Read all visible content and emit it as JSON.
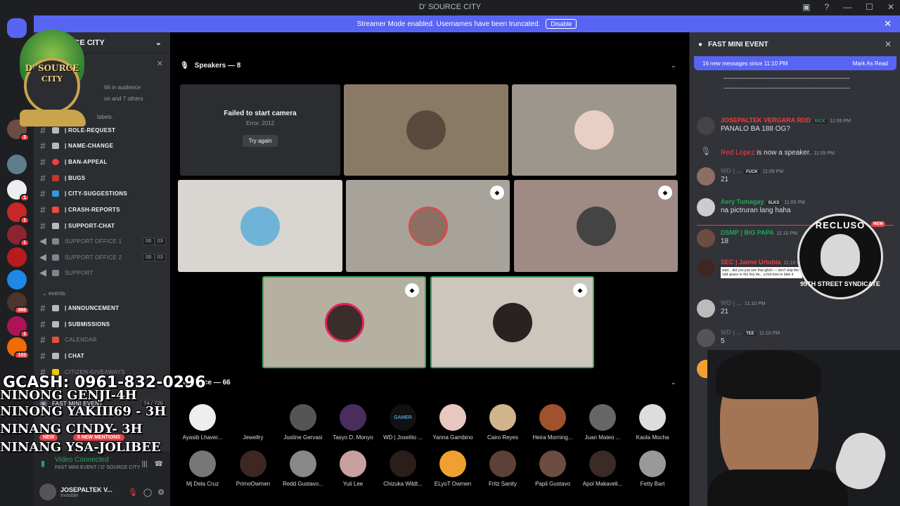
{
  "window": {
    "title": "D' SOURCE CITY"
  },
  "banner": {
    "text": "Streamer Mode enabled. Usernames have been truncated.",
    "button": "Disable"
  },
  "sidebar": {
    "guild_name": "D' SOURCE CITY",
    "stage_info": {
      "audience": "66 in audience",
      "others": "on and 7 others"
    },
    "channels": [
      {
        "label": "| ROLE-REQUEST",
        "dim": false
      },
      {
        "label": "| NAME-CHANGE",
        "dim": false
      },
      {
        "label": "| BAN-APPEAL",
        "dim": false
      },
      {
        "label": "| BUGS",
        "dim": false
      },
      {
        "label": "| CITY-SUGGESTIONS",
        "dim": false
      },
      {
        "label": "| CRASH-REPORTS",
        "dim": false
      },
      {
        "label": "| SUPPORT-CHAT",
        "dim": false
      },
      {
        "label": "SUPPORT OFFICE 1",
        "dim": true,
        "count": [
          "00",
          "03"
        ]
      },
      {
        "label": "SUPPORT OFFICE 2",
        "dim": true,
        "count": [
          "00",
          "03"
        ]
      },
      {
        "label": "SUPPORT",
        "dim": true
      }
    ],
    "category_events": "events.",
    "category_label": "labels.",
    "event_channels": [
      {
        "label": "| ANNOUNCEMENT",
        "dim": false
      },
      {
        "label": "| SUBMISSIONS",
        "dim": false
      },
      {
        "label": "CALENDAR",
        "dim": true
      },
      {
        "label": "| CHAT",
        "dim": false
      },
      {
        "label": "CITIZEN-GIVEAWAYS",
        "dim": true
      }
    ],
    "voice": {
      "status": "Video Connected",
      "location": "FAST MINI EVENT / D' SOURCE CITY",
      "stage_item": "FAST MINI EVENT",
      "stage_counts": "74 / 720",
      "mentions": "5 NEW MENTIONS",
      "new_label": "NEW"
    },
    "user": {
      "name": "JOSEPALTEK V...",
      "status": "Invisible"
    }
  },
  "rail_badges": [
    "3",
    "1",
    "1",
    "1",
    "366",
    "1",
    "103"
  ],
  "stage": {
    "speakers_header": "Speakers — 8",
    "audience_header": "Audience — 66",
    "camera_error": {
      "title": "Failed to start camera",
      "code": "Error: 2012",
      "retry": "Try again"
    },
    "audience": [
      "Ayasib Lhaver...",
      "Jewellry",
      "Justine Gervasi",
      "Tasyo D. Monyo",
      "WD | Joselito ...",
      "Yanna Gambino",
      "Cairo Reyes",
      "Heira Morning...",
      "Juan Mateo ...",
      "Kaola Mocha",
      "Mj Dela Cruz",
      "PrimoOwmen",
      "Redd Gustavo...",
      "Yuii Lee",
      "Chizuka Wildt...",
      "ELyoT Owmen",
      "Fritz Sanity",
      "Papii Gustavo",
      "Apol Makaveli...",
      "Fetty Bart"
    ]
  },
  "chat": {
    "title": "FAST MINI EVENT",
    "new_messages": "16 new messages since 11:10 PM",
    "mark_read": "Mark As Read",
    "dashes": "------------------------------------------------------------",
    "messages": [
      {
        "name": "JOSEPALTEK VERGARA RDD",
        "color": "#f23f43",
        "tag": "KICK",
        "time": "11:09 PM",
        "text": "PANALO BA 188 OG?"
      },
      {
        "name": "Red Lopez",
        "color": "#f23f43",
        "time": "11:09 PM",
        "text": "is now a speaker."
      },
      {
        "name": "WD | ...",
        "color": "#5d6069",
        "tag": "FUCK",
        "time": "11:09 PM",
        "text": "21"
      },
      {
        "name": "Aery Tumagay",
        "color": "#23a55a",
        "tag": "SLKS",
        "time": "11:09 PM",
        "text": "na pictruran lang haha"
      },
      {
        "name": "DSMP | BIG PAPA",
        "color": "#23a55a",
        "time": "11:10 PM",
        "text": "18"
      },
      {
        "name": "SEC | Jaime Urtubia",
        "color": "#f23f43",
        "time": "11:10 PM",
        "text": "wait... did you just see that glitch — don't skip the odd space or the tiny de... a bot tries to fake it"
      },
      {
        "name": "WD | ...",
        "color": "#5d6069",
        "time": "11:10 PM",
        "text": "21"
      },
      {
        "name": "WD | ...",
        "color": "#5d6069",
        "tag": "TEE",
        "time": "11:10 PM",
        "text": "5"
      }
    ]
  },
  "overlays": {
    "logo_line1": "D' SOURCE",
    "logo_line2": "CITY",
    "gcash": "GCASH: 0961-832-0296",
    "donors": [
      "NINONG GENJI-4H",
      "NINONG YAKIII69 - 3H",
      "NINANG CINDY- 3H",
      "NINANG YSA-JOLIBEE"
    ],
    "reclus_top": "RECLUSO",
    "reclus_bottom": "95TH STREET SYNDICATE",
    "reclus_new": "NEW"
  },
  "colors": {
    "accent": "#5865f2",
    "speaking": "#3ba55d",
    "danger": "#f23f43"
  }
}
